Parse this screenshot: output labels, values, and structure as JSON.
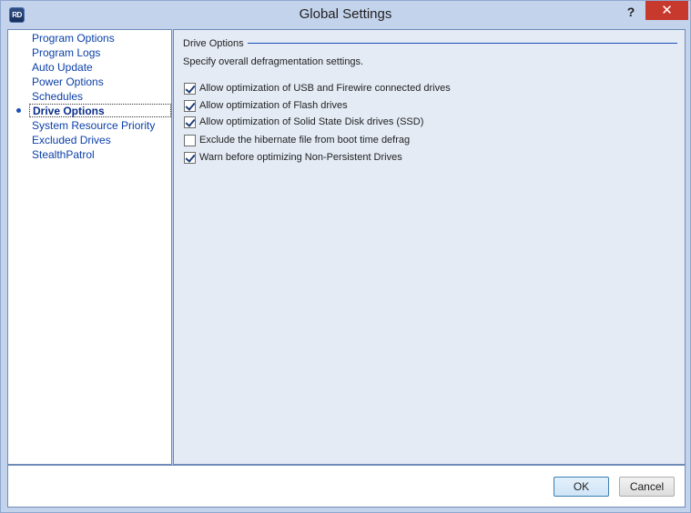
{
  "window": {
    "title": "Global Settings",
    "app_icon": "RD",
    "help_label": "?",
    "close_label": "✕"
  },
  "nav": {
    "items": [
      {
        "label": "Program Options"
      },
      {
        "label": "Program Logs"
      },
      {
        "label": "Auto Update"
      },
      {
        "label": "Power Options"
      },
      {
        "label": "Schedules"
      },
      {
        "label": "Drive Options"
      },
      {
        "label": "System Resource Priority"
      },
      {
        "label": "Excluded Drives"
      },
      {
        "label": "StealthPatrol"
      }
    ],
    "selected_index": 5
  },
  "content": {
    "section_title": "Drive Options",
    "description": "Specify overall defragmentation settings.",
    "options": [
      {
        "label": "Allow optimization of USB and Firewire connected drives",
        "checked": true
      },
      {
        "label": "Allow optimization of Flash drives",
        "checked": true
      },
      {
        "label": "Allow optimization of Solid State Disk drives (SSD)",
        "checked": true
      },
      {
        "label": "Exclude the hibernate file from boot time defrag",
        "checked": false
      },
      {
        "label": "Warn before optimizing Non-Persistent Drives",
        "checked": true
      }
    ]
  },
  "buttons": {
    "ok": "OK",
    "cancel": "Cancel"
  },
  "colors": {
    "link": "#0b3fa8",
    "close": "#c7392d",
    "frame": "#c3d3ec"
  }
}
